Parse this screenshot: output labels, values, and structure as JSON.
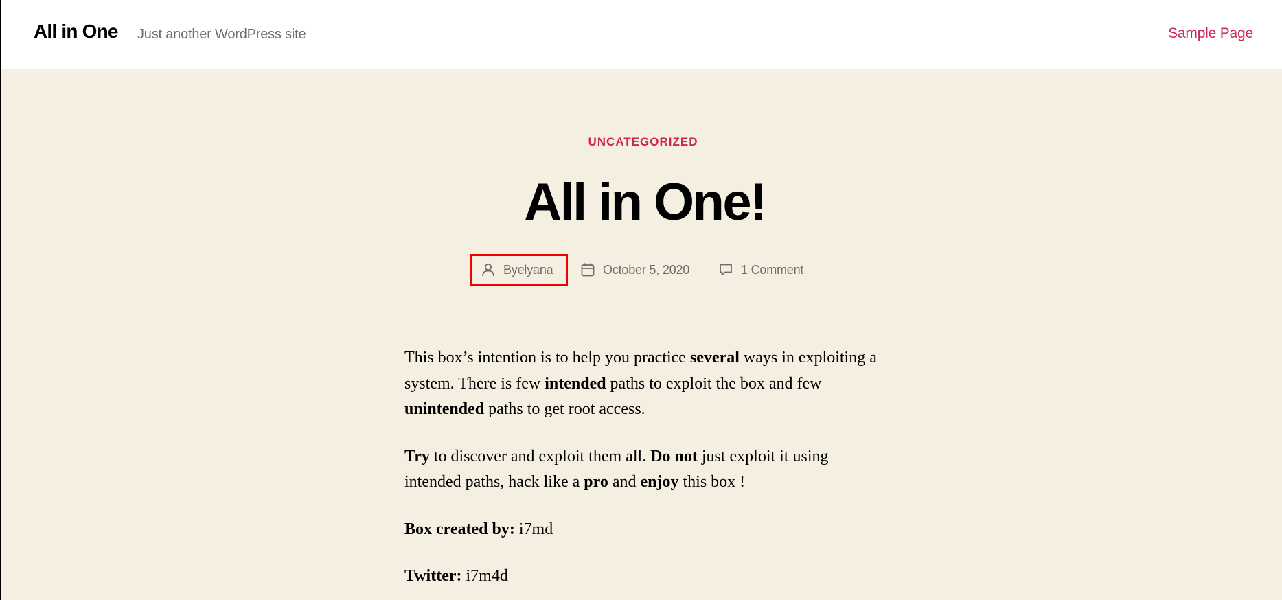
{
  "site": {
    "title": "All in One",
    "description": "Just another WordPress site"
  },
  "nav": {
    "items": [
      "Sample Page"
    ]
  },
  "post": {
    "category": "UNCATEGORIZED",
    "title": "All in One!",
    "meta": {
      "author_prefix": "By ",
      "author": "elyana",
      "date": "October 5, 2020",
      "comments": "1 Comment"
    },
    "content": {
      "p1": {
        "t1": "This box’s intention is to help you practice ",
        "b1": "several",
        "t2": " ways in exploiting a system. There is few ",
        "b2": "intended",
        "t3": " paths to exploit the box and few ",
        "b3": "unintended",
        "t4": " paths to get root access."
      },
      "p2": {
        "b1": "Try",
        "t1": " to discover and exploit them all. ",
        "b2": "Do not",
        "t2": " just exploit it using intended paths, hack like a ",
        "b3": "pro",
        "t3": " and ",
        "b4": "enjoy",
        "t4": " this box !"
      },
      "p3": {
        "label": "Box created by:",
        "value": " i7md"
      },
      "p4": {
        "label": "Twitter:",
        "value": " i7m4d"
      }
    }
  },
  "icons": {
    "author": "user-icon",
    "date": "calendar-icon",
    "comments": "comment-icon"
  },
  "colors": {
    "accent": "#cd2653",
    "background": "#f4efe0",
    "header_background": "#ffffff",
    "meta_text": "#6d6d6d",
    "highlight_box": "#ee0000"
  }
}
